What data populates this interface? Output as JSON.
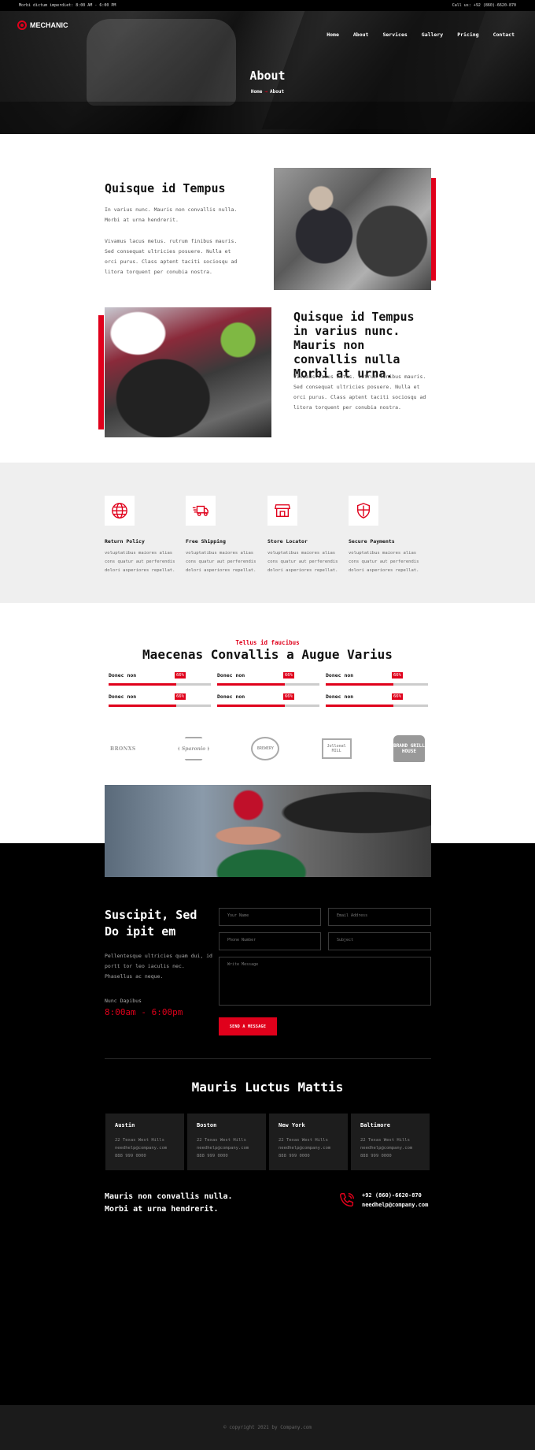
{
  "topbar": {
    "left": "Morbi dictum imperdiet: 8:00 AM - 6:00 PM",
    "right": "Call us: +92 (860)-6620-870"
  },
  "brand": {
    "name": "MECHANIC"
  },
  "nav": [
    "Home",
    "About",
    "Services",
    "Gallery",
    "Pricing",
    "Contact"
  ],
  "hero": {
    "title": "About",
    "crumb_home": "Home",
    "crumb_sep": "→",
    "crumb_current": "About"
  },
  "about1": {
    "title": "Quisque id Tempus",
    "p1": "In varius nunc. Mauris non convallis nulla. Morbi at urna hendrerit.",
    "p2": "Vivamus lacus metus. rutrum finibus mauris. Sed consequat ultricies posuere. Nulla et orci purus. Class aptent taciti sociosqu ad litora torquent per conubia nostra."
  },
  "about2": {
    "title": "Quisque id Tempus in varius nunc. Mauris non convallis nulla Morbi at urna.",
    "p": "Vivamus lacus metus. rutrum finibus mauris. Sed consequat ultricies posuere. Nulla et orci purus. Class aptent taciti sociosqu ad litora torquent per conubia nostra."
  },
  "features": [
    {
      "icon": "globe-icon",
      "title": "Return Policy",
      "text": "voluptatibus maiores alias cons quatur aut perferendis dolori asperiores repellat."
    },
    {
      "icon": "delivery-truck-icon",
      "title": "Free Shipping",
      "text": "voluptatibus maiores alias cons quatur aut perferendis dolori asperiores repellat."
    },
    {
      "icon": "store-icon",
      "title": "Store Locator",
      "text": "voluptatibus maiores alias cons quatur aut perferendis dolori asperiores repellat."
    },
    {
      "icon": "shield-icon",
      "title": "Secure Payments",
      "text": "voluptatibus maiores alias cons quatur aut perferendis dolori asperiores repellat."
    }
  ],
  "skills": {
    "kicker": "Tellus id faucibus",
    "title": "Maecenas Convallis a Augue Varius",
    "items": [
      {
        "label": "Donec non",
        "pct": "66%",
        "value": 0.66
      },
      {
        "label": "Donec non",
        "pct": "66%",
        "value": 0.66
      },
      {
        "label": "Donec non",
        "pct": "66%",
        "value": 0.66
      },
      {
        "label": "Donec non",
        "pct": "66%",
        "value": 0.66
      },
      {
        "label": "Donec non",
        "pct": "66%",
        "value": 0.66
      },
      {
        "label": "Donec non",
        "pct": "66%",
        "value": 0.66
      }
    ]
  },
  "brands": [
    "BRONXS",
    "Sparonio",
    "BREWERY",
    "Jollonal MILL",
    "BRAND GRILL HOUSE"
  ],
  "contact": {
    "title": "Suscipit, Sed Do ipit em",
    "text": "Pellentesque ultricies quam dui, id portt tor leo iaculis nec. Phasellus ac neque.",
    "hours_label": "Nunc Dapibus",
    "hours": "8:00am - 6:00pm",
    "fields": {
      "name": "Your Name",
      "email": "Email Address",
      "phone": "Phone Number",
      "subject": "Subject",
      "message": "Write Message"
    },
    "send": "SEND A MESSAGE"
  },
  "locations": {
    "title": "Mauris Luctus Mattis",
    "items": [
      {
        "city": "Austin",
        "addr": "22 Texas West Hills",
        "email": "needhelp@company.com",
        "phone": "888 999 0000"
      },
      {
        "city": "Boston",
        "addr": "22 Texas West Hills",
        "email": "needhelp@company.com",
        "phone": "888 999 0000"
      },
      {
        "city": "New York",
        "addr": "22 Texas West Hills",
        "email": "needhelp@company.com",
        "phone": "888 999 0000"
      },
      {
        "city": "Baltimore",
        "addr": "22 Texas West Hills",
        "email": "needhelp@company.com",
        "phone": "888 999 0000"
      }
    ]
  },
  "footer": {
    "tagline1": "Mauris non convallis nulla.",
    "tagline2": "Morbi at urna hendrerit.",
    "phone": "+92 (860)-6620-870",
    "email": "needhelp@company.com",
    "copyright": "© copyright 2021 by Company.com"
  },
  "colors": {
    "accent": "#e0001b",
    "dark": "#000000",
    "light_gray": "#efefef"
  }
}
